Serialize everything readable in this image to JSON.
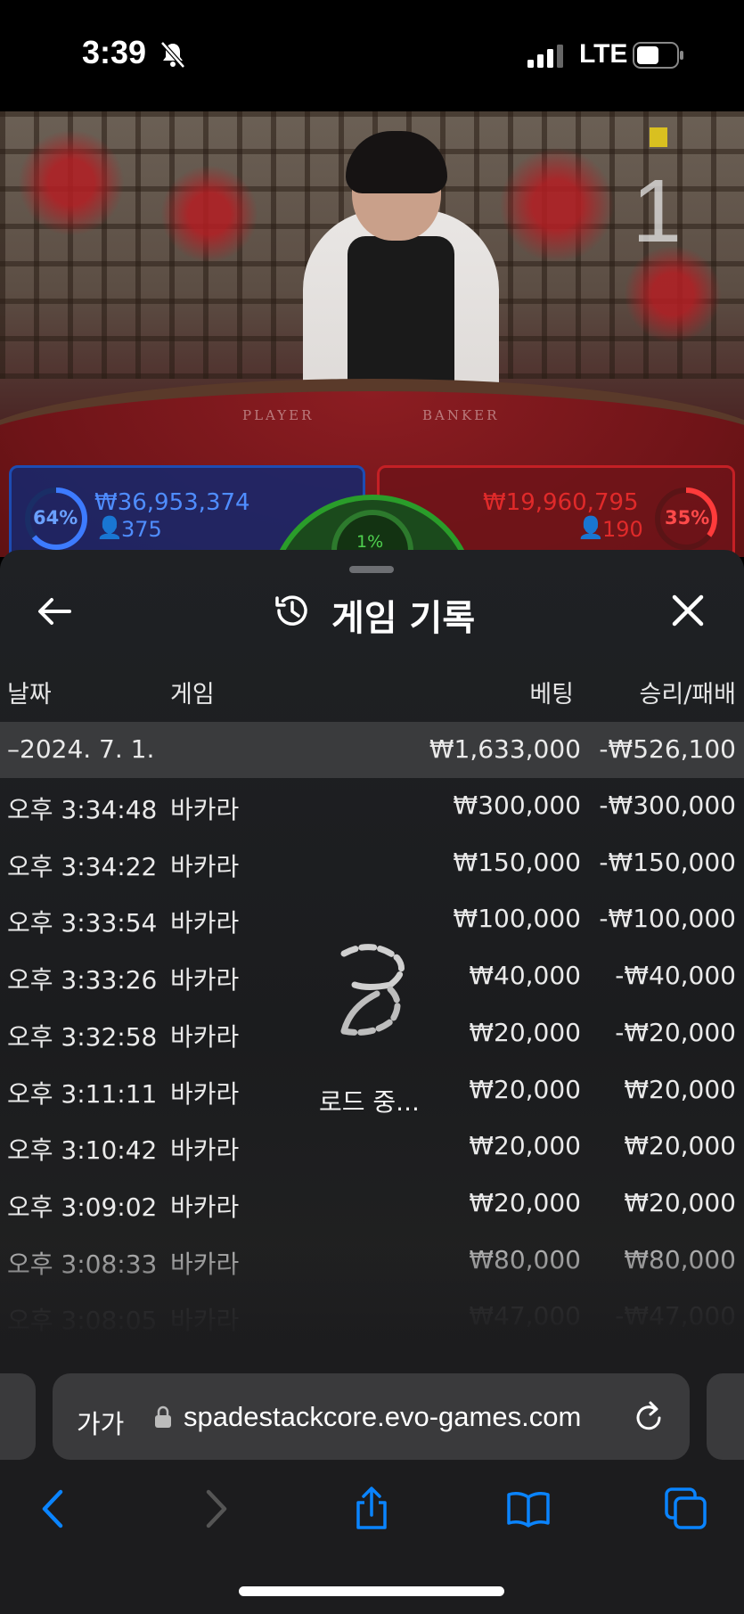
{
  "status_bar": {
    "time": "3:39",
    "network": "LTE"
  },
  "video": {
    "round_number": "1",
    "table_left": "PLAYER",
    "table_right": "BANKER",
    "player": {
      "percent": "64%",
      "amount": "₩36,953,374",
      "count": "375"
    },
    "banker": {
      "percent": "35%",
      "amount": "₩19,960,795",
      "count": "190"
    },
    "tie": {
      "percent": "1%"
    }
  },
  "history": {
    "title": "게임 기록",
    "columns": {
      "date": "날짜",
      "game": "게임",
      "bet": "베팅",
      "winloss": "승리/패배"
    },
    "summary": {
      "date": "–2024. 7. 1.",
      "bet": "₩1,633,000",
      "winloss": "-₩526,100"
    },
    "rows": [
      {
        "time": "오후 3:34:48",
        "game": "바카라",
        "bet": "₩300,000",
        "winloss": "-₩300,000"
      },
      {
        "time": "오후 3:34:22",
        "game": "바카라",
        "bet": "₩150,000",
        "winloss": "-₩150,000"
      },
      {
        "time": "오후 3:33:54",
        "game": "바카라",
        "bet": "₩100,000",
        "winloss": "-₩100,000"
      },
      {
        "time": "오후 3:33:26",
        "game": "바카라",
        "bet": "₩40,000",
        "winloss": "-₩40,000"
      },
      {
        "time": "오후 3:32:58",
        "game": "바카라",
        "bet": "₩20,000",
        "winloss": "-₩20,000"
      },
      {
        "time": "오후 3:11:11",
        "game": "바카라",
        "bet": "₩20,000",
        "winloss": "₩20,000"
      },
      {
        "time": "오후 3:10:42",
        "game": "바카라",
        "bet": "₩20,000",
        "winloss": "₩20,000"
      },
      {
        "time": "오후 3:09:02",
        "game": "바카라",
        "bet": "₩20,000",
        "winloss": "₩20,000"
      },
      {
        "time": "오후 3:08:33",
        "game": "바카라",
        "bet": "₩80,000",
        "winloss": "₩80,000"
      },
      {
        "time": "오후 3:08:05",
        "game": "바카라",
        "bet": "₩47,000",
        "winloss": "-₩47,000"
      }
    ],
    "loading_text": "로드 중..."
  },
  "browser": {
    "text_size_label": "가가",
    "url": "spadestackcore.evo-games.com"
  },
  "colors": {
    "player_blue": "#1d4cb3",
    "banker_red": "#c42025",
    "tie_green": "#2a9d2a",
    "browser_blue": "#0a84ff"
  }
}
